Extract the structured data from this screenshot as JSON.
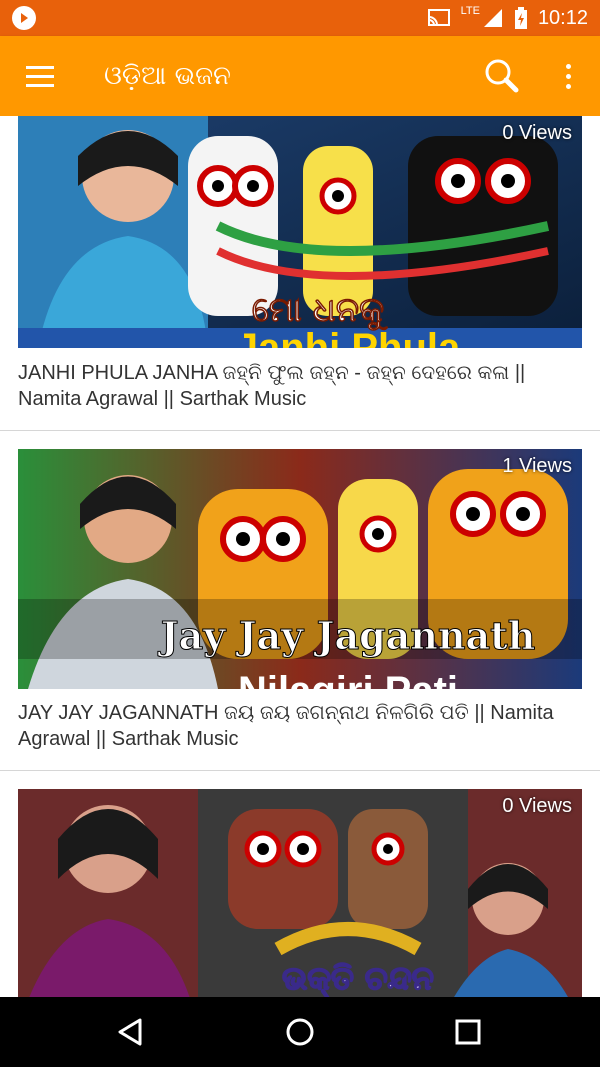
{
  "status_bar": {
    "time": "10:12",
    "network": "LTE"
  },
  "app_bar": {
    "title": "ଓଡ଼ିଆ ଭଜନ"
  },
  "videos": [
    {
      "views": "0 Views",
      "title": "JANHI PHULA JANHA ଜହ୍ନି ଫୁଲ ଜହ୍ନ - ଜହ୍ନ ଦେହରେ କଳା || Namita Agrawal || Sarthak Music",
      "overlay_text": "ମୋ ଧନକୁ",
      "overlay_text_2": "Janhi Phula"
    },
    {
      "views": "1 Views",
      "title": "JAY JAY JAGANNATH ଜୟ ଜୟ ଜଗନ୍ନାଥ ନିଳଗିରି ପତି || Namita Agrawal || Sarthak Music",
      "overlay_text": "Jay Jay Jagannath",
      "overlay_text_2": "Nilagiri Pati"
    },
    {
      "views": "0 Views",
      "title": "",
      "overlay_text": "ଭକ୍ତି ଚନ୍ଦନ",
      "overlay_text_2": ""
    }
  ],
  "colors": {
    "status_bar": "#e8610b",
    "app_bar": "#ff9800",
    "nav_bar": "#000000"
  }
}
